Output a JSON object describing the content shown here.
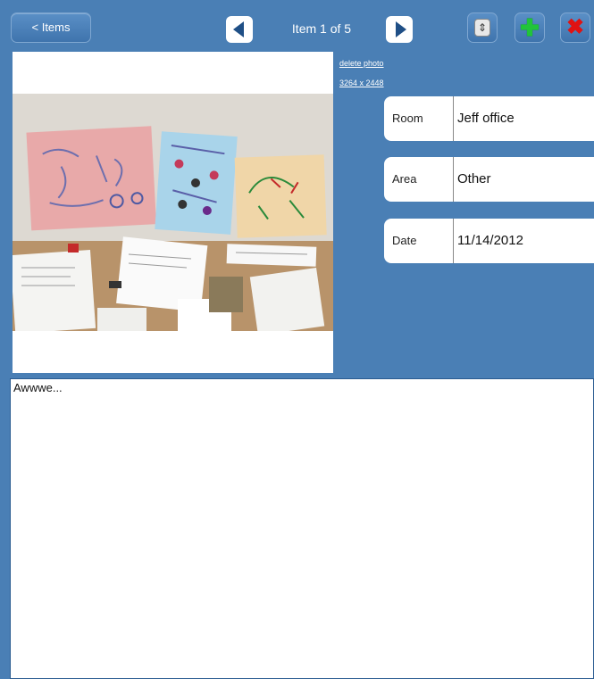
{
  "toolbar": {
    "back_label": "< Items",
    "counter": "Item 1 of 5",
    "sort_icon": "sort-icon",
    "add_icon": "plus-icon",
    "delete_icon": "x-icon"
  },
  "photo": {
    "delete_link": "delete photo",
    "dimensions": "3264 x 2448"
  },
  "fields": [
    {
      "label": "Room",
      "value": "Jeff office"
    },
    {
      "label": "Area",
      "value": "Other"
    },
    {
      "label": "Date",
      "value": "11/14/2012"
    }
  ],
  "notes": {
    "text": "Awwwe..."
  },
  "colors": {
    "background": "#4a7fb5",
    "add_green": "#21c43a",
    "delete_red": "#e01212"
  }
}
